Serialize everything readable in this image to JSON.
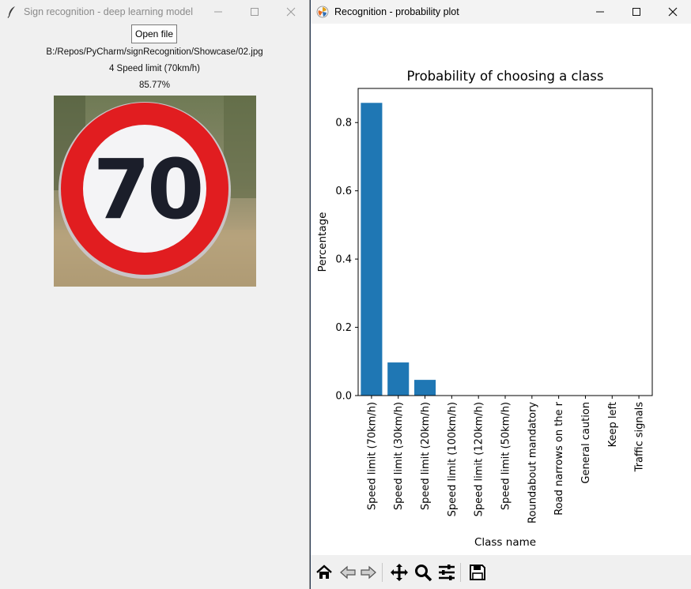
{
  "left_window": {
    "title": "Sign recognition - deep learning model",
    "open_button": "Open file",
    "file_path": "B:/Repos/PyCharm/signRecognition/Showcase/02.jpg",
    "prediction": "4 Speed limit (70km/h)",
    "confidence": "85.77%",
    "sign_number": "70"
  },
  "right_window": {
    "title": "Recognition - probability plot"
  },
  "chart_data": {
    "type": "bar",
    "title": "Probability of choosing a class",
    "xlabel": "Class name",
    "ylabel": "Percentage",
    "ylim": [
      0,
      0.9
    ],
    "yticks": [
      "0.0",
      "0.2",
      "0.4",
      "0.6",
      "0.8"
    ],
    "categories": [
      "Speed limit (70km/h)",
      "Speed limit (30km/h)",
      "Speed limit (20km/h)",
      "Speed limit (100km/h)",
      "Speed limit (120km/h)",
      "Speed limit (50km/h)",
      "Roundabout mandatory",
      "Road narrows on the r",
      "General caution",
      "Keep left",
      "Traffic signals"
    ],
    "values": [
      0.8577,
      0.097,
      0.046,
      0.0,
      0.0,
      0.0,
      0.0,
      0.0,
      0.0,
      0.0,
      0.0
    ],
    "bar_color": "#1f77b4",
    "grid": false,
    "legend": "none"
  },
  "toolbar": [
    "home-icon",
    "back-icon",
    "forward-icon",
    "pan-icon",
    "zoom-icon",
    "configure-subplots-icon",
    "save-icon"
  ]
}
